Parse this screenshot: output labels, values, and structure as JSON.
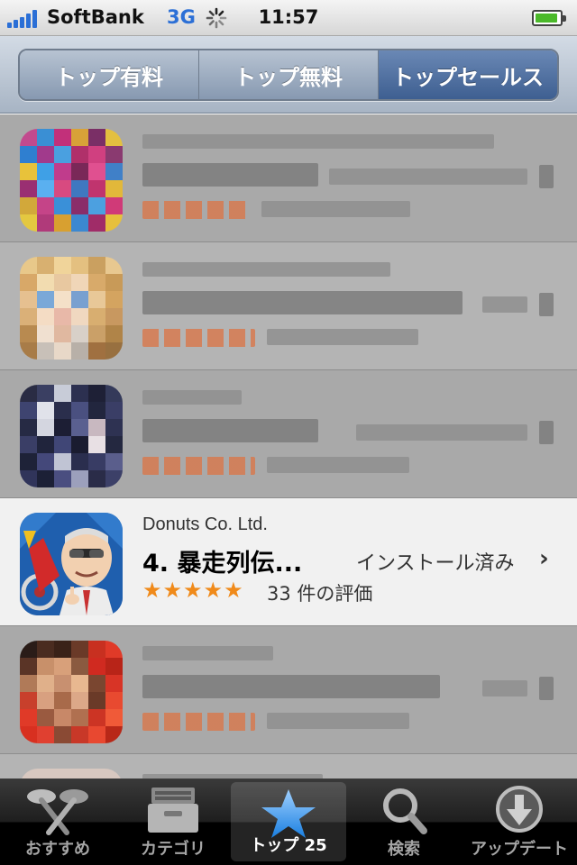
{
  "statusbar": {
    "carrier": "SoftBank",
    "network": "3G",
    "time": "11:57"
  },
  "segments": [
    {
      "label": "トップ有料",
      "active": false
    },
    {
      "label": "トップ無料",
      "active": false
    },
    {
      "label": "トップセールス",
      "active": true
    }
  ],
  "featured_app": {
    "developer": "Donuts Co. Ltd.",
    "title": "4. 暴走列伝...",
    "status": "インストール済み",
    "stars": "★★★★★",
    "rating_count": "33 件の評価"
  },
  "tabbar": {
    "items": [
      {
        "label": "おすすめ",
        "icon": "featured-icon",
        "active": false
      },
      {
        "label": "カテゴリ",
        "icon": "categories-icon",
        "active": false
      },
      {
        "label": "トップ 25",
        "icon": "star-icon",
        "active": true
      },
      {
        "label": "検索",
        "icon": "search-icon",
        "active": false
      },
      {
        "label": "アップデート",
        "icon": "updates-icon",
        "active": false
      }
    ]
  }
}
